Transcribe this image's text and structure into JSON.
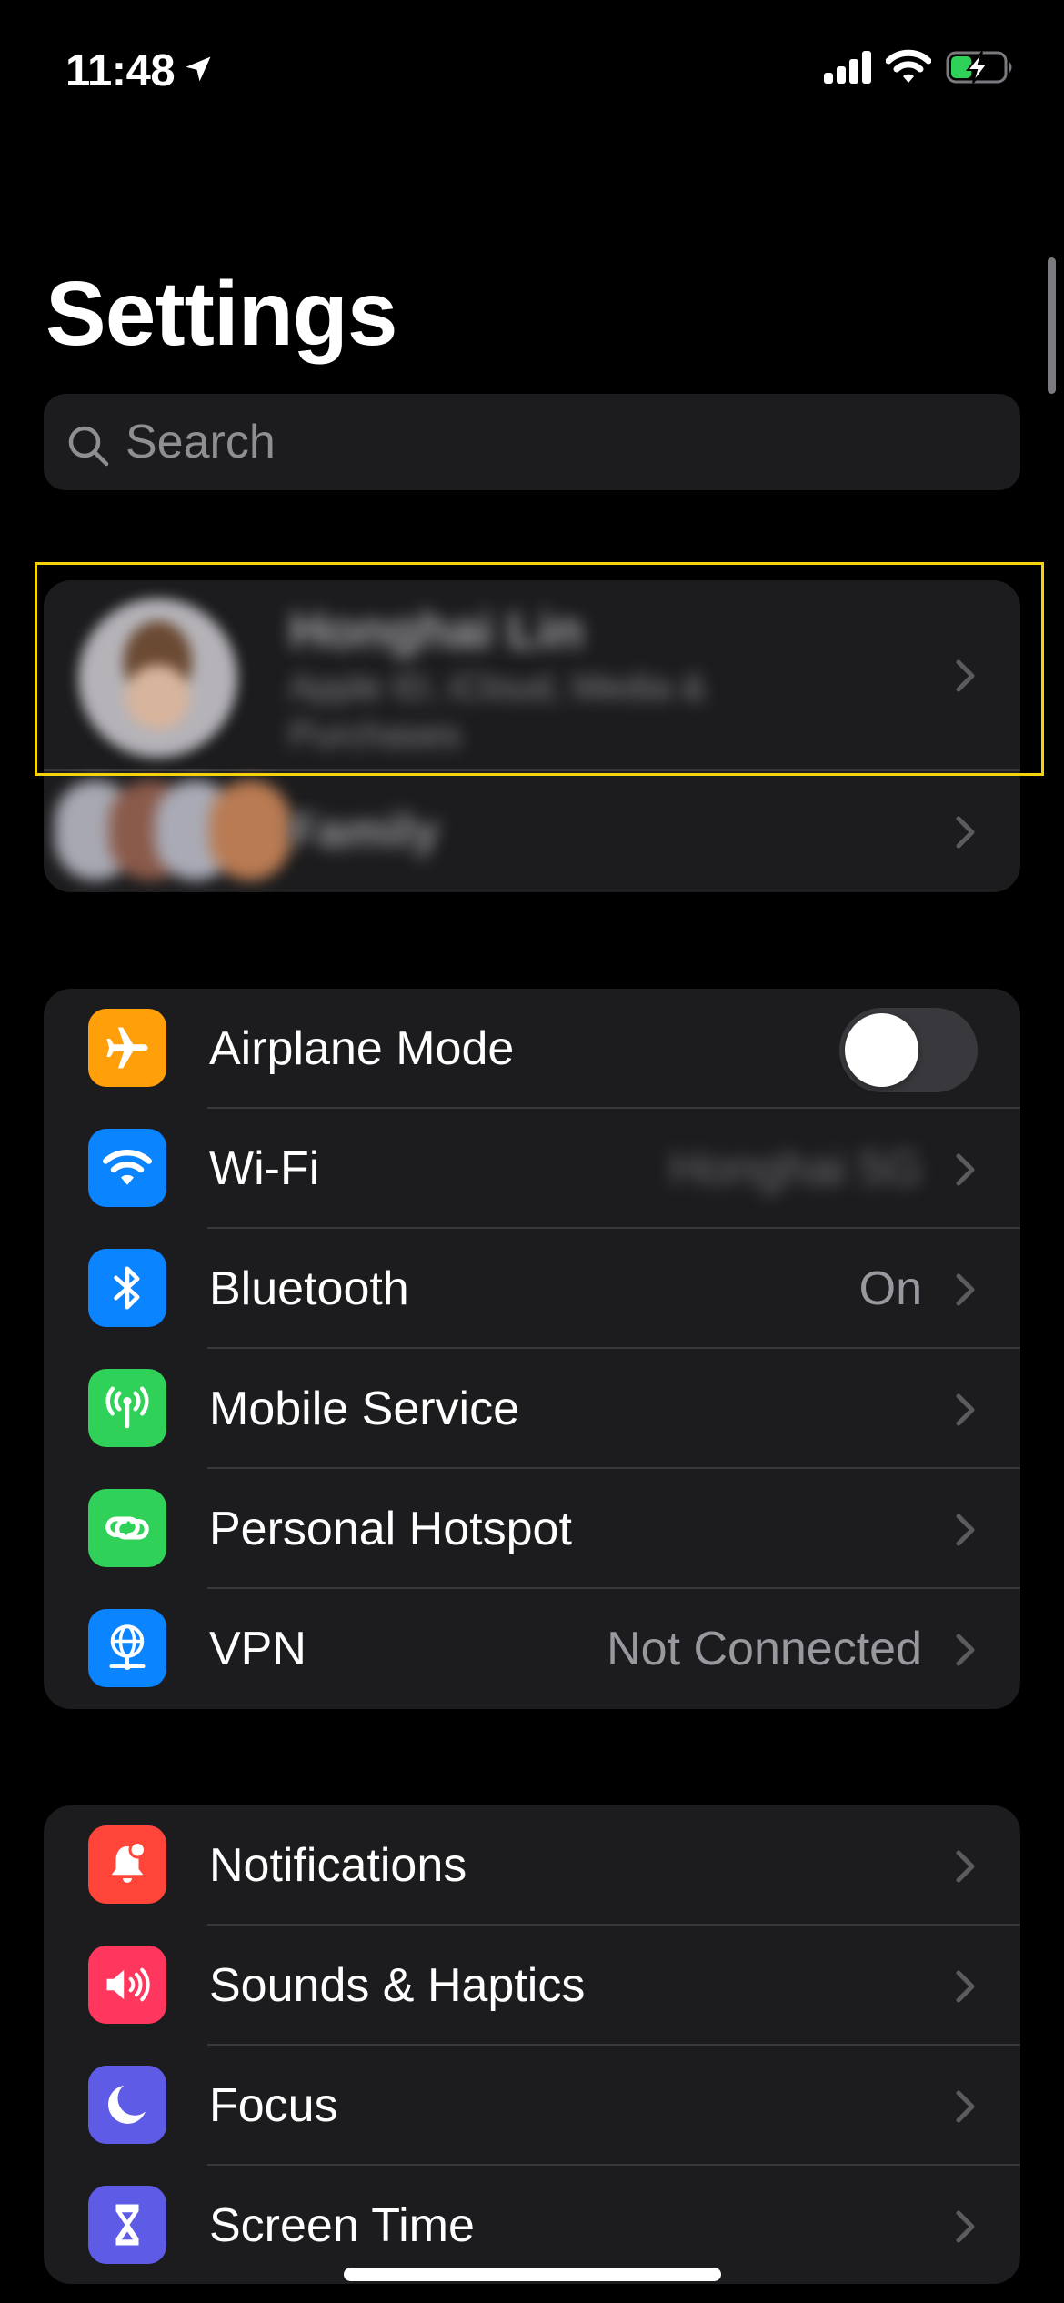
{
  "status_bar": {
    "time": "11:48",
    "location_icon": "location-arrow-icon",
    "signal_icon": "cellular-signal-icon",
    "wifi_icon": "wifi-icon",
    "battery_icon": "battery-charging-icon",
    "battery_level": 0.4,
    "battery_color": "#30d158"
  },
  "header": {
    "title": "Settings"
  },
  "search": {
    "placeholder": "Search",
    "value": "",
    "icon": "search-icon"
  },
  "profile": {
    "name": "Honghai Lin",
    "subtitle": "Apple ID, iCloud, Media & Purchases",
    "family_label": "Family",
    "blurred": true
  },
  "groups": [
    {
      "items": [
        {
          "label": "Airplane Mode",
          "icon": "airplane-icon",
          "color": "#ff9f0a",
          "control": "toggle",
          "toggle_on": false
        },
        {
          "label": "Wi-Fi",
          "icon": "wifi-icon",
          "color": "#0a84ff",
          "value": "Honghai 5G",
          "value_blurred": true
        },
        {
          "label": "Bluetooth",
          "icon": "bluetooth-icon",
          "color": "#0a84ff",
          "value": "On"
        },
        {
          "label": "Mobile Service",
          "icon": "antenna-icon",
          "color": "#30d158"
        },
        {
          "label": "Personal Hotspot",
          "icon": "link-icon",
          "color": "#30d158"
        },
        {
          "label": "VPN",
          "icon": "vpn-globe-icon",
          "color": "#0a84ff",
          "value": "Not Connected"
        }
      ]
    },
    {
      "items": [
        {
          "label": "Notifications",
          "icon": "bell-badge-icon",
          "color": "#ff453a"
        },
        {
          "label": "Sounds & Haptics",
          "icon": "speaker-icon",
          "color": "#ff375f"
        },
        {
          "label": "Focus",
          "icon": "moon-icon",
          "color": "#5e5ce6"
        },
        {
          "label": "Screen Time",
          "icon": "hourglass-icon",
          "color": "#5e5ce6"
        }
      ]
    }
  ],
  "colors": {
    "background": "#000000",
    "cell": "#1c1c1e",
    "secondary_text": "#98989f",
    "chevron": "#5a5a5f",
    "highlight": "#f5d30a"
  }
}
